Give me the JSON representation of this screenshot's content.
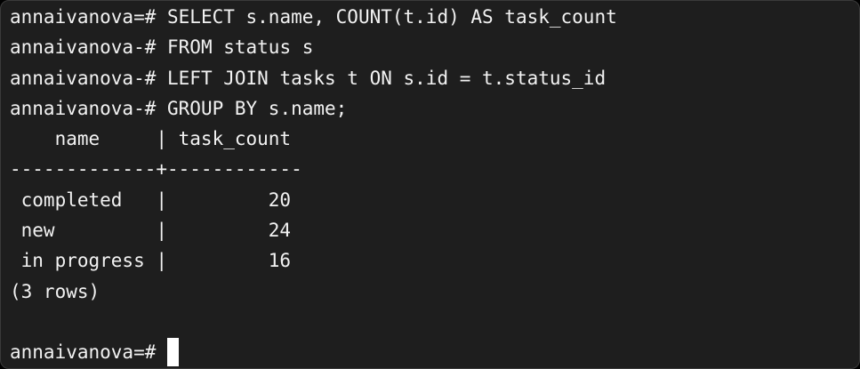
{
  "terminal": {
    "lines": [
      {
        "prompt": "annaivanova=# ",
        "text": "SELECT s.name, COUNT(t.id) AS task_count"
      },
      {
        "prompt": "annaivanova-# ",
        "text": "FROM status s"
      },
      {
        "prompt": "annaivanova-# ",
        "text": "LEFT JOIN tasks t ON s.id = t.status_id"
      },
      {
        "prompt": "annaivanova-# ",
        "text": "GROUP BY s.name;"
      }
    ],
    "result": {
      "header": "    name     | task_count",
      "separator": "-------------+------------",
      "rows": [
        " completed   |         20",
        " new         |         24",
        " in progress |         16"
      ],
      "footer": "(3 rows)"
    },
    "current_prompt": "annaivanova=# "
  }
}
